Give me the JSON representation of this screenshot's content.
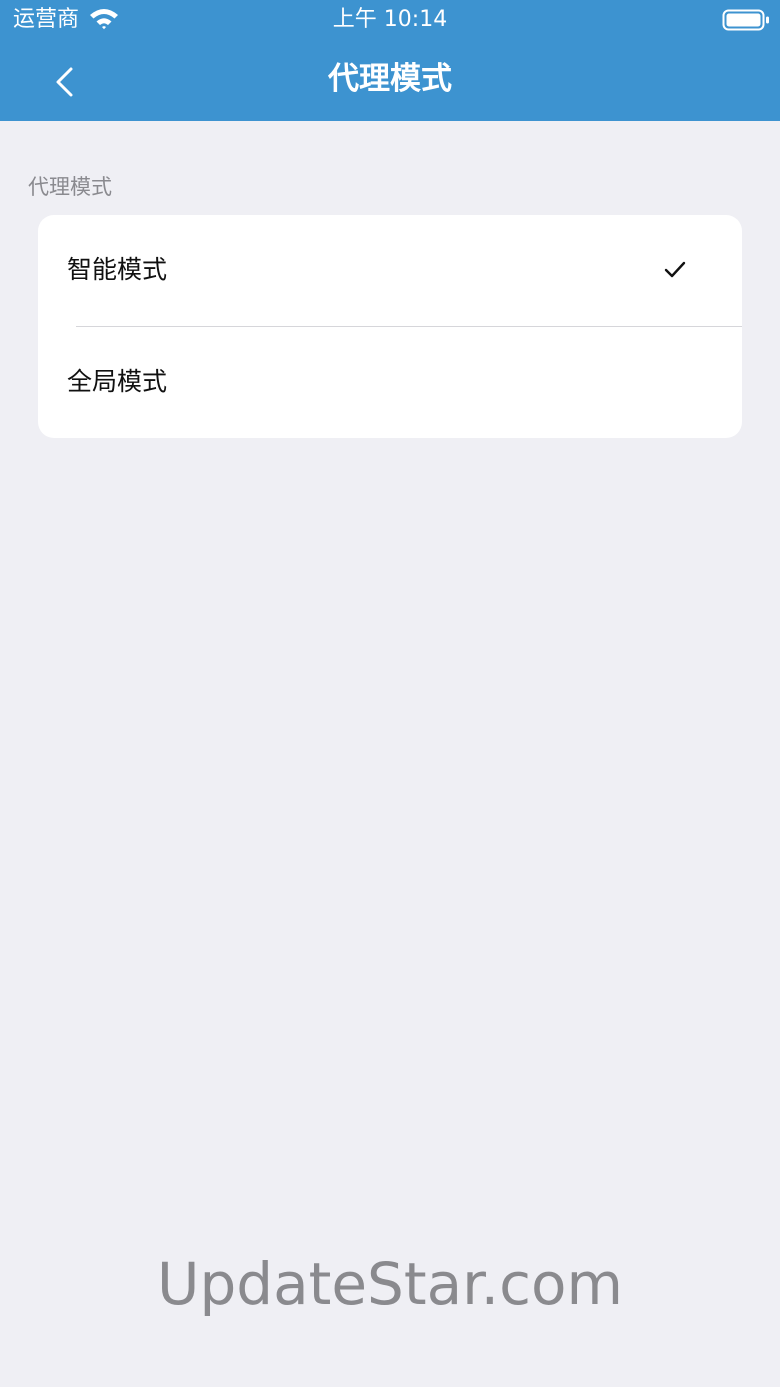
{
  "status_bar": {
    "carrier": "运营商",
    "time": "上午 10:14",
    "wifi_icon": "wifi-icon",
    "battery_icon": "battery-icon"
  },
  "nav_bar": {
    "title": "代理模式",
    "back_icon": "chevron-left-icon",
    "background_color": "#3d93d0"
  },
  "section": {
    "header": "代理模式",
    "options": [
      {
        "label": "智能模式",
        "selected": true
      },
      {
        "label": "全局模式",
        "selected": false
      }
    ],
    "check_icon": "checkmark-icon"
  },
  "watermark": "UpdateStar.com",
  "colors": {
    "page_background": "#efeff4",
    "card_background": "#ffffff",
    "secondary_text": "#8a8a8f"
  }
}
